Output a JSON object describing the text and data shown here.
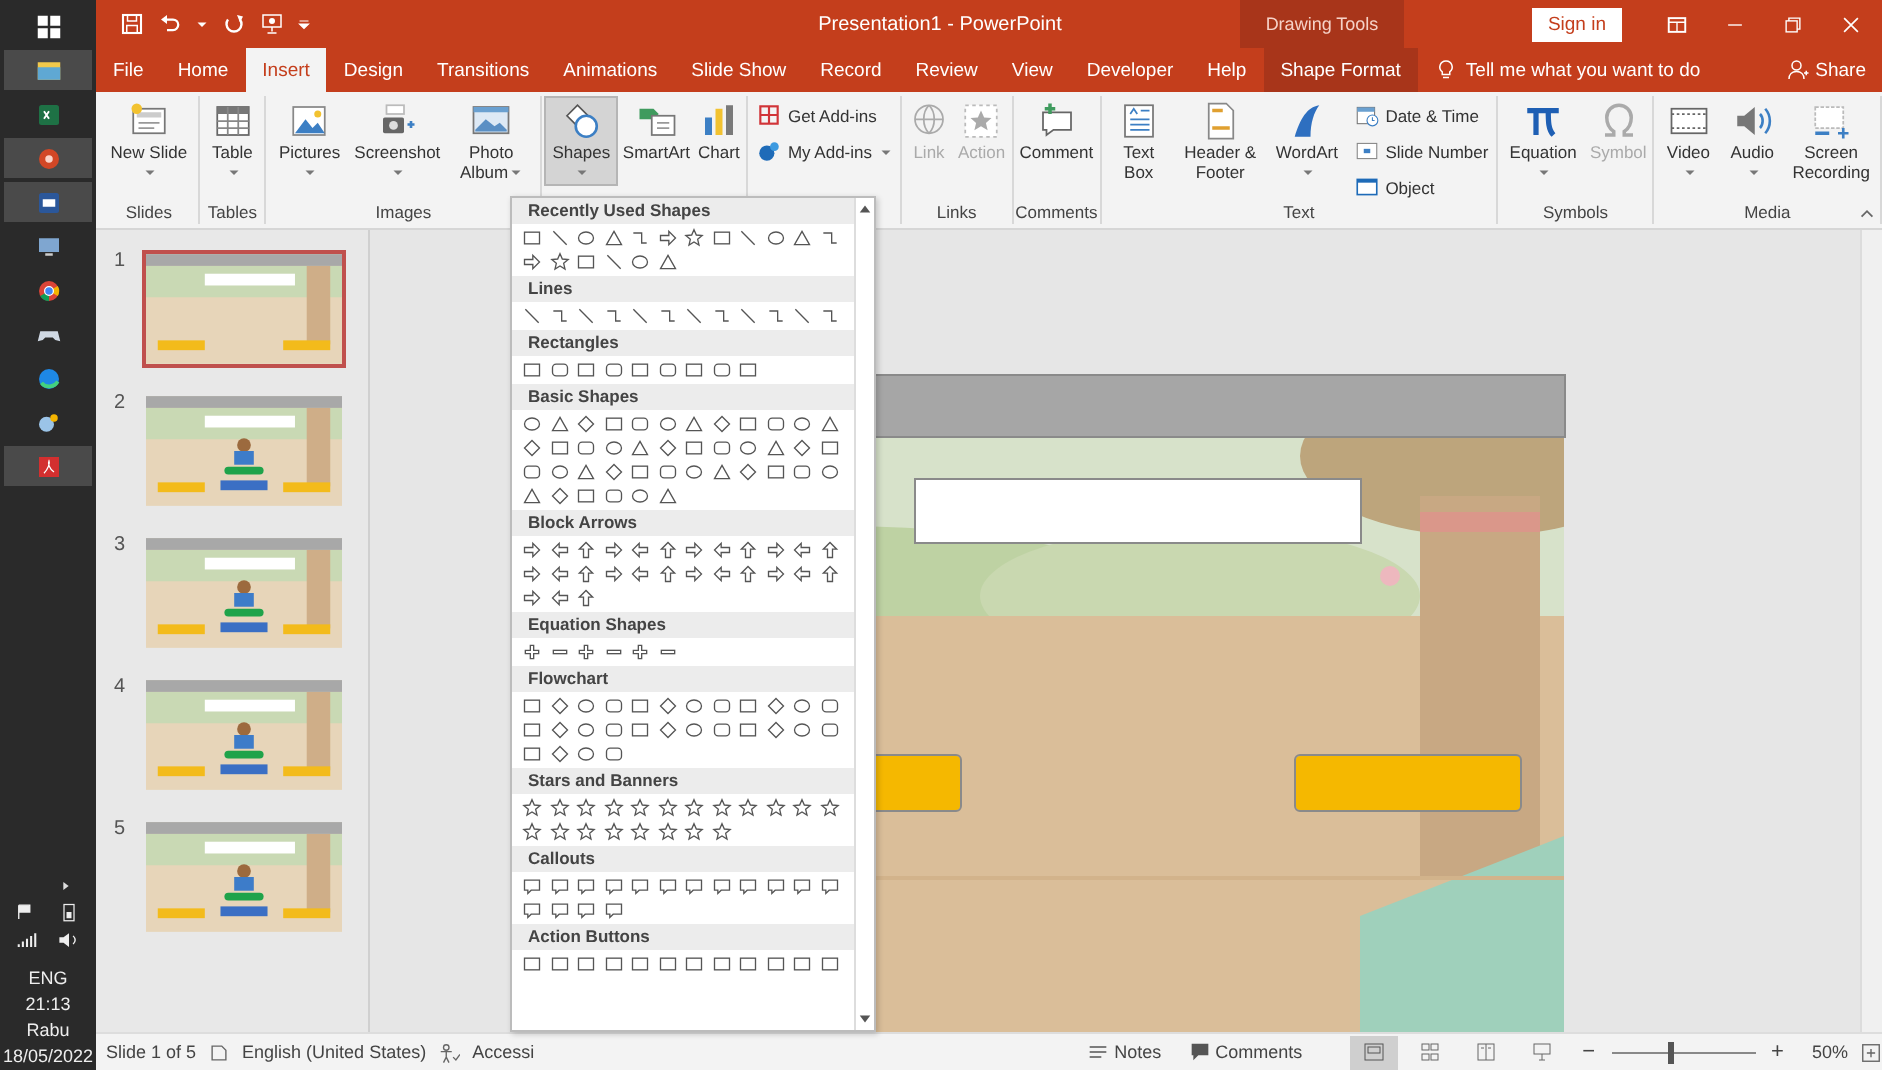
{
  "taskbar": {
    "apps": [
      {
        "active": false
      },
      {
        "active": true
      },
      {
        "active": false
      },
      {
        "active": true
      },
      {
        "active": true
      },
      {
        "active": false
      },
      {
        "active": false
      },
      {
        "active": false
      },
      {
        "active": false
      },
      {
        "active": false
      },
      {
        "active": true
      }
    ],
    "tray": {
      "language": "ENG",
      "time": "21:13",
      "day": "Rabu",
      "date": "18/05/2022"
    }
  },
  "window": {
    "title": "Presentation1  -  PowerPoint",
    "context_title": "Drawing Tools",
    "sign_in": "Sign in"
  },
  "tabs": [
    {
      "label": "File",
      "selected": false,
      "contextual": false
    },
    {
      "label": "Home",
      "selected": false,
      "contextual": false
    },
    {
      "label": "Insert",
      "selected": true,
      "contextual": false
    },
    {
      "label": "Design",
      "selected": false,
      "contextual": false
    },
    {
      "label": "Transitions",
      "selected": false,
      "contextual": false
    },
    {
      "label": "Animations",
      "selected": false,
      "contextual": false
    },
    {
      "label": "Slide Show",
      "selected": false,
      "contextual": false
    },
    {
      "label": "Record",
      "selected": false,
      "contextual": false
    },
    {
      "label": "Review",
      "selected": false,
      "contextual": false
    },
    {
      "label": "View",
      "selected": false,
      "contextual": false
    },
    {
      "label": "Developer",
      "selected": false,
      "contextual": false
    },
    {
      "label": "Help",
      "selected": false,
      "contextual": false
    },
    {
      "label": "Shape Format",
      "selected": false,
      "contextual": true
    }
  ],
  "tell_me": {
    "placeholder": "Tell me what you want to do"
  },
  "share": "Share",
  "ribbon": {
    "groups": [
      {
        "label": "Slides",
        "commands": [
          {
            "label": "New Slide",
            "kind": "large",
            "dropdown": true,
            "disabled": false,
            "pressed": false
          }
        ]
      },
      {
        "label": "Tables",
        "commands": [
          {
            "label": "Table",
            "kind": "large",
            "dropdown": true,
            "disabled": false,
            "pressed": false
          }
        ]
      },
      {
        "label": "Images",
        "commands": [
          {
            "label": "Pictures",
            "kind": "large",
            "dropdown": true,
            "disabled": false,
            "pressed": false
          },
          {
            "label": "Screenshot",
            "kind": "large",
            "dropdown": true,
            "disabled": false,
            "pressed": false
          },
          {
            "label": "Photo Album",
            "kind": "large",
            "dropdown": true,
            "disabled": false,
            "pressed": false
          }
        ]
      },
      {
        "commands": [
          {
            "label": "Shapes",
            "kind": "large",
            "dropdown": true,
            "disabled": false,
            "pressed": true
          },
          {
            "label": "SmartArt",
            "kind": "large",
            "dropdown": false,
            "disabled": false,
            "pressed": false
          },
          {
            "label": "Chart",
            "kind": "large",
            "dropdown": false,
            "disabled": false,
            "pressed": false
          }
        ]
      },
      {
        "commands": [
          {
            "label": "Get Add-ins",
            "kind": "small",
            "dropdown": false,
            "disabled": false,
            "pressed": false
          },
          {
            "label": "My Add-ins",
            "kind": "small",
            "dropdown": true,
            "disabled": false,
            "pressed": false
          }
        ]
      },
      {
        "label": "Links",
        "commands": [
          {
            "label": "Link",
            "kind": "large",
            "dropdown": false,
            "disabled": true,
            "pressed": false
          },
          {
            "label": "Action",
            "kind": "large",
            "dropdown": false,
            "disabled": true,
            "pressed": false
          }
        ]
      },
      {
        "label": "Comments",
        "commands": [
          {
            "label": "Comment",
            "kind": "large",
            "dropdown": false,
            "disabled": false,
            "pressed": false
          }
        ]
      },
      {
        "label": "Text",
        "commands": [
          {
            "label": "Text Box",
            "kind": "large",
            "dropdown": false,
            "disabled": false,
            "pressed": false
          },
          {
            "label": "Header & Footer",
            "kind": "large",
            "dropdown": false,
            "disabled": false,
            "pressed": false
          },
          {
            "label": "WordArt",
            "kind": "large",
            "dropdown": true,
            "disabled": false,
            "pressed": false
          },
          {
            "label": "Date & Time",
            "kind": "small",
            "dropdown": false,
            "disabled": false,
            "pressed": false
          },
          {
            "label": "Slide Number",
            "kind": "small",
            "dropdown": false,
            "disabled": false,
            "pressed": false
          },
          {
            "label": "Object",
            "kind": "small",
            "dropdown": false,
            "disabled": false,
            "pressed": false
          }
        ]
      },
      {
        "label": "Symbols",
        "commands": [
          {
            "label": "Equation",
            "kind": "large",
            "dropdown": true,
            "disabled": false,
            "pressed": false
          },
          {
            "label": "Symbol",
            "kind": "large",
            "dropdown": false,
            "disabled": true,
            "pressed": false
          }
        ]
      },
      {
        "label": "Media",
        "commands": [
          {
            "label": "Video",
            "kind": "large",
            "dropdown": true,
            "disabled": false,
            "pressed": false
          },
          {
            "label": "Audio",
            "kind": "large",
            "dropdown": true,
            "disabled": false,
            "pressed": false
          },
          {
            "label": "Screen Recording",
            "kind": "large",
            "dropdown": false,
            "disabled": false,
            "pressed": false
          }
        ]
      }
    ]
  },
  "slides_panel": {
    "slides": [
      {
        "number": "1",
        "selected": true,
        "kind": "title"
      },
      {
        "number": "2",
        "selected": false,
        "kind": "question"
      },
      {
        "number": "3",
        "selected": false,
        "kind": "question"
      },
      {
        "number": "4",
        "selected": false,
        "kind": "question"
      },
      {
        "number": "5",
        "selected": false,
        "kind": "question"
      }
    ]
  },
  "slide": {
    "kind": "picture",
    "shapes": [
      {
        "kind": "title_bar",
        "selected": true
      },
      {
        "kind": "text_box",
        "selected": true
      },
      {
        "kind": "answer_button",
        "selected": true
      },
      {
        "kind": "answer_button",
        "selected": true
      }
    ]
  },
  "shapes_gallery": {
    "sections": [
      {
        "title": "Recently Used Shapes"
      },
      {
        "title": "Lines"
      },
      {
        "title": "Rectangles"
      },
      {
        "title": "Basic Shapes"
      },
      {
        "title": "Block Arrows"
      },
      {
        "title": "Equation Shapes"
      },
      {
        "title": "Flowchart"
      },
      {
        "title": "Stars and Banners"
      },
      {
        "title": "Callouts"
      },
      {
        "title": "Action Buttons"
      }
    ]
  },
  "status_bar": {
    "slide_info": "Slide 1 of 5",
    "language": "English (United States)",
    "accessibility": "Accessi",
    "notes": "Notes",
    "comments": "Comments",
    "views": [
      {
        "selected": true
      },
      {
        "selected": false
      },
      {
        "selected": false
      },
      {
        "selected": false
      }
    ],
    "zoom_out": "−",
    "zoom_in": "+",
    "zoom": {
      "level": 0.4,
      "reading": "50%"
    }
  }
}
